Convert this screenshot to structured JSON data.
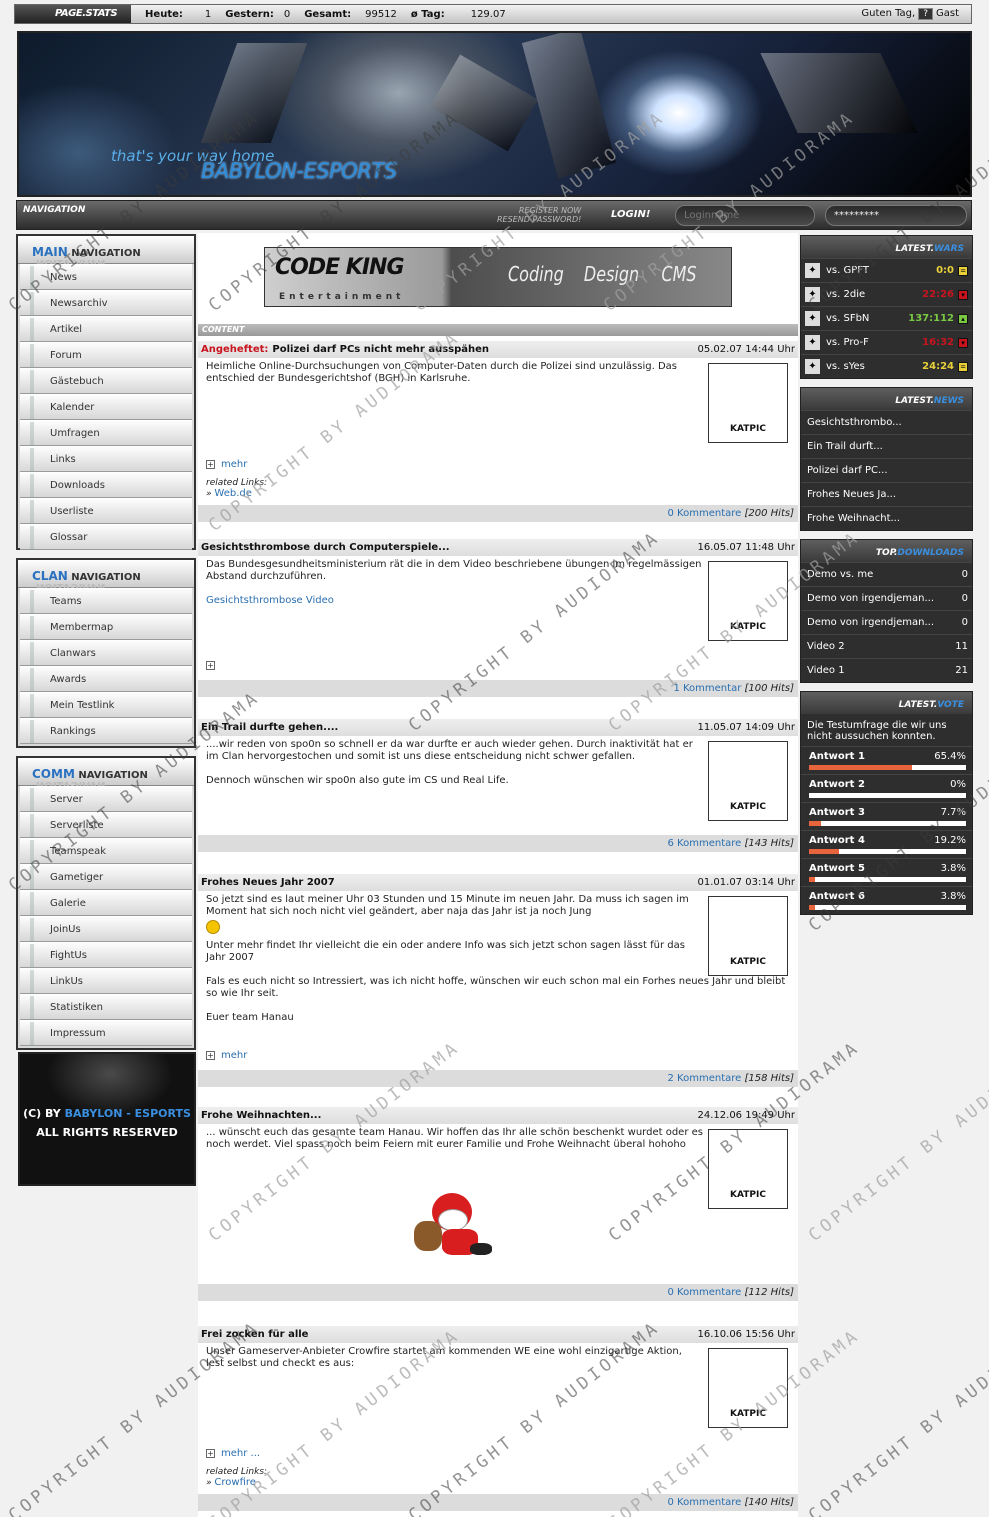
{
  "topbar": {
    "title": "PAGE.STATS",
    "heute_label": "Heute:",
    "heute": "1",
    "gestern_label": "Gestern:",
    "gestern": "0",
    "gesamt_label": "Gesamt:",
    "gesamt": "99512",
    "tag_label": "ø Tag:",
    "tag": "129.07",
    "greet": "Guten Tag,",
    "q": "?",
    "user": "Gast"
  },
  "header": {
    "tagline": "that's your way home",
    "brand": "BABYLON-ESPORTS"
  },
  "navbar": {
    "title": "NAVIGATION",
    "register": "REGISTER NOW",
    "resend": "RESEND PASSWORD!",
    "login": "LOGIN!",
    "user_placeholder": "Loginname",
    "pass_value": "*********"
  },
  "main_nav": {
    "b": "MAIN",
    "rest": "NAVIGATION",
    "ghost": "NAVIGATION",
    "items": [
      "News",
      "Newsarchiv",
      "Artikel",
      "Forum",
      "Gästebuch",
      "Kalender",
      "Umfragen",
      "Links",
      "Downloads",
      "Userliste",
      "Glossar"
    ]
  },
  "clan_nav": {
    "b": "CLAN",
    "rest": "NAVIGATION",
    "ghost": "NAVIGATION",
    "items": [
      "Teams",
      "Membermap",
      "Clanwars",
      "Awards",
      "Mein Testlink",
      "Rankings"
    ]
  },
  "comm_nav": {
    "b": "COMM",
    "rest": "NAVIGATION",
    "ghost": "NAVIGATION",
    "items": [
      "Server",
      "Serverliste",
      "Teamspeak",
      "Gametiger",
      "Galerie",
      "JoinUs",
      "FightUs",
      "LinkUs",
      "Statistiken",
      "Impressum"
    ]
  },
  "footer": {
    "line1a": "(C) BY",
    "line1b": "BABYLON - ESPORTS",
    "line2": "ALL RIGHTS RESERVED"
  },
  "banner": {
    "logo": "CODE KING",
    "ent": "Entertainment",
    "w1": "Coding",
    "w2": "Design",
    "w3": "CMS"
  },
  "content_title": "CONTENT",
  "pic_label": "KATPIC",
  "news": [
    {
      "pin": "Angeheftet:",
      "title": "Polizei darf PCs nicht mehr ausspähen",
      "date": "05.02.07 14:44 Uhr",
      "text": "Heimliche Online-Durchsuchungen von Computer-Daten durch die Polizei sind unzulässig. Das entschied der Bundesgerichtshof (BGH) in Karlsruhe.",
      "more": "mehr",
      "rel_label": "related Links:",
      "rel_link": "Web.de",
      "comments": "0 Kommentare",
      "hits": "[200 Hits]"
    },
    {
      "title": "Gesichtsthrombose durch Computerspiele...",
      "date": "16.05.07 11:48 Uhr",
      "text": "Das Bundesgesundheitsministerium rät die in dem Video beschriebene übungen im regelmässigen Abstand durchzuführen.",
      "link": "Gesichtsthrombose Video",
      "comments": "1 Kommentar",
      "hits": "[100 Hits]"
    },
    {
      "title": "Ein Trail durfte gehen....",
      "date": "11.05.07 14:09 Uhr",
      "text": "....wir reden von spo0n so schnell er da war durfte er auch wieder gehen. Durch inaktivität hat er im Clan hervorgestochen und somit ist uns diese entscheidung nicht schwer gefallen.",
      "text2": "Dennoch wünschen wir spo0n also gute im CS und Real Life.",
      "comments": "6 Kommentare",
      "hits": "[143 Hits]"
    },
    {
      "title": "Frohes Neues Jahr 2007",
      "date": "01.01.07 03:14 Uhr",
      "text": "So jetzt sind es laut meiner Uhr 03 Stunden und 15 Minute im neuen Jahr. Da muss ich sagen im Moment hat sich noch nicht viel geändert, aber naja das Jahr ist ja noch Jung",
      "text2": "Unter mehr findet Ihr vielleicht die ein oder andere Info was sich jetzt schon sagen lässt für das Jahr 2007",
      "text3": "Fals es euch nicht so Intressiert, was ich nicht hoffe, wünschen wir euch schon mal ein Forhes neues Jahr und bleibt so wie Ihr seit.",
      "text4": "Euer team Hanau",
      "more": "mehr",
      "comments": "2 Kommentare",
      "hits": "[158 Hits]"
    },
    {
      "title": "Frohe Weihnachten...",
      "date": "24.12.06 19:49 Uhr",
      "text": "... wünscht euch das gesamte team Hanau. Wir hoffen das Ihr alle schön beschenkt wurdet oder es noch werdet. Viel spass noch beim Feiern mit eurer Familie und Frohe Weihnacht überal hohoho",
      "comments": "0 Kommentare",
      "hits": "[112 Hits]"
    },
    {
      "title": "Frei zocken für alle",
      "date": "16.10.06 15:56 Uhr",
      "text": "Unser Gameserver-Anbieter Crowfire startet am kommenden WE eine wohl einzigartige Aktion, lest selbst und checkt es aus:",
      "more": "mehr ...",
      "rel_label": "related Links:",
      "rel_link": "Crowfire",
      "comments": "0 Kommentare",
      "hits": "[140 Hits]"
    }
  ],
  "wars": {
    "title_a": "LATEST.",
    "title_b": "WARS",
    "rows": [
      {
        "opp": "vs. GPFT",
        "score": "0:0",
        "color": "#e8d03a",
        "status": "="
      },
      {
        "opp": "vs. 2die",
        "score": "22:26",
        "color": "#c8141e",
        "status": "▾"
      },
      {
        "opp": "vs. SFbN",
        "score": "137:112",
        "color": "#7ac943",
        "status": "▴"
      },
      {
        "opp": "vs. Pro-F",
        "score": "16:32",
        "color": "#c8141e",
        "status": "▾"
      },
      {
        "opp": "vs. sYes",
        "score": "24:24",
        "color": "#e8d03a",
        "status": "="
      }
    ]
  },
  "latest_news": {
    "title_a": "LATEST.",
    "title_b": "NEWS",
    "items": [
      "Gesichtsthrombo...",
      "Ein Trail durft...",
      "Polizei darf PC...",
      "Frohes Neues Ja...",
      "Frohe Weihnacht..."
    ]
  },
  "downloads": {
    "title_a": "TOP.",
    "title_b": "DOWNLOADS",
    "items": [
      {
        "name": "Demo vs. me",
        "n": "0"
      },
      {
        "name": "Demo von irgendjeman...",
        "n": "0"
      },
      {
        "name": "Demo von irgendjeman...",
        "n": "0"
      },
      {
        "name": "Video 2",
        "n": "11"
      },
      {
        "name": "Video 1",
        "n": "21"
      }
    ]
  },
  "vote": {
    "title_a": "LATEST.",
    "title_b": "VOTE",
    "question": "Die Testumfrage die wir uns nicht aussuchen konnten.",
    "answers": [
      {
        "label": "Antwort 1",
        "pct": "65.4%",
        "frac": 0.654
      },
      {
        "label": "Antwort 2",
        "pct": "0%",
        "frac": 0
      },
      {
        "label": "Antwort 3",
        "pct": "7.7%",
        "frac": 0.077
      },
      {
        "label": "Antwort 4",
        "pct": "19.2%",
        "frac": 0.192
      },
      {
        "label": "Antwort 5",
        "pct": "3.8%",
        "frac": 0.038
      },
      {
        "label": "Antwort 6",
        "pct": "3.8%",
        "frac": 0.038
      }
    ]
  },
  "watermark": "COPYRIGHT BY AUDIORAMA"
}
